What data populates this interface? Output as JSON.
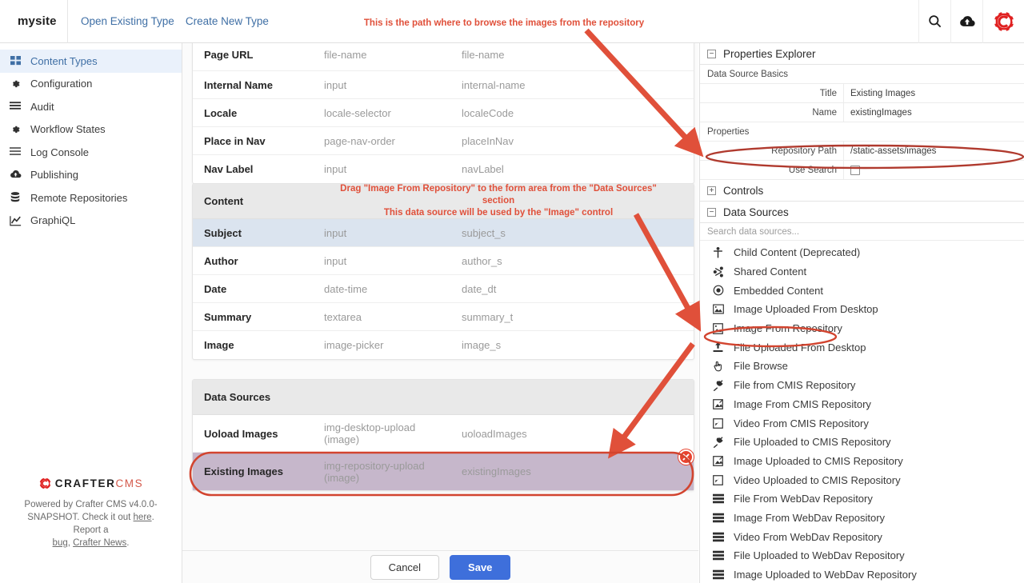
{
  "topbar": {
    "site_name": "mysite",
    "nav": [
      {
        "label": "Open Existing Type"
      },
      {
        "label": "Create New Type"
      }
    ],
    "icons": {
      "search": "search-icon",
      "publish": "cloud-upload-icon",
      "logo": "crafter-gear-logo"
    }
  },
  "sidebar": {
    "items": [
      {
        "label": "Content Types",
        "icon": "grid-icon",
        "active": true
      },
      {
        "label": "Configuration",
        "icon": "gear-icon",
        "active": false
      },
      {
        "label": "Audit",
        "icon": "list-icon",
        "active": false
      },
      {
        "label": "Workflow States",
        "icon": "gear-icon",
        "active": false
      },
      {
        "label": "Log Console",
        "icon": "list-icon",
        "active": false
      },
      {
        "label": "Publishing",
        "icon": "cloud-upload-icon",
        "active": false
      },
      {
        "label": "Remote Repositories",
        "icon": "database-icon",
        "active": false
      },
      {
        "label": "GraphiQL",
        "icon": "chart-line-icon",
        "active": false
      }
    ]
  },
  "footer": {
    "brand_main": "CRAFTER",
    "brand_sub": "CMS",
    "line1": "Powered by Crafter CMS v4.0.0-",
    "line2_a": "SNAPSHOT. Check it out ",
    "line2_link": "here",
    "line2_b": ". Report a",
    "line3_link1": "bug",
    "line3_sep": ", ",
    "line3_link2": "Crafter News",
    "line3_end": "."
  },
  "form": {
    "top_rows": [
      {
        "name": "Page URL",
        "control": "file-name",
        "field": "file-name"
      },
      {
        "name": "Internal Name",
        "control": "input",
        "field": "internal-name"
      },
      {
        "name": "Locale",
        "control": "locale-selector",
        "field": "localeCode"
      },
      {
        "name": "Place in Nav",
        "control": "page-nav-order",
        "field": "placeInNav"
      },
      {
        "name": "Nav Label",
        "control": "input",
        "field": "navLabel"
      }
    ],
    "content_section": {
      "title": "Content",
      "note_line1": "Drag \"Image From Repository\" to the form area from the \"Data Sources\" section",
      "note_line2": "This data source will be used by the \"Image\" control",
      "rows": [
        {
          "name": "Subject",
          "control": "input",
          "field": "subject_s",
          "selected": true
        },
        {
          "name": "Author",
          "control": "input",
          "field": "author_s",
          "selected": false
        },
        {
          "name": "Date",
          "control": "date-time",
          "field": "date_dt",
          "selected": false
        },
        {
          "name": "Summary",
          "control": "textarea",
          "field": "summary_t",
          "selected": false
        },
        {
          "name": "Image",
          "control": "image-picker",
          "field": "image_s",
          "selected": false
        }
      ]
    },
    "datasources_section": {
      "title": "Data Sources",
      "rows": [
        {
          "name": "Uoload Images",
          "control": "img-desktop-upload\n(image)",
          "field": "uoloadImages",
          "chosen": false
        },
        {
          "name": "Existing Images",
          "control": "img-repository-upload\n(image)",
          "field": "existingImages",
          "chosen": true
        }
      ]
    },
    "buttons": {
      "cancel": "Cancel",
      "save": "Save"
    }
  },
  "properties_explorer": {
    "title": "Properties Explorer",
    "sections": {
      "basics_title": "Data Source Basics",
      "basics_rows": [
        {
          "label": "Title",
          "value": "Existing Images"
        },
        {
          "label": "Name",
          "value": "existingImages"
        }
      ],
      "properties_title": "Properties",
      "properties_rows": [
        {
          "label": "Repository Path",
          "value": "/static-assets/images",
          "type": "text-search",
          "highlighted": true
        },
        {
          "label": "Use Search",
          "value": "",
          "type": "checkbox",
          "checked": false,
          "highlighted": false
        }
      ],
      "controls_title": "Controls",
      "datasources_title": "Data Sources"
    },
    "search_placeholder": "Search data sources...",
    "datasource_items": [
      {
        "label": "Child Content (Deprecated)",
        "icon": "person-icon",
        "highlighted": false
      },
      {
        "label": "Shared Content",
        "icon": "share-icon",
        "highlighted": false
      },
      {
        "label": "Embedded Content",
        "icon": "target-icon",
        "highlighted": false
      },
      {
        "label": "Image Uploaded From Desktop",
        "icon": "image-icon",
        "highlighted": false
      },
      {
        "label": "Image From Repository",
        "icon": "image-doc-icon",
        "highlighted": true
      },
      {
        "label": "File Uploaded From Desktop",
        "icon": "upload-icon",
        "highlighted": false
      },
      {
        "label": "File Browse",
        "icon": "hand-icon",
        "highlighted": false
      },
      {
        "label": "File from CMIS Repository",
        "icon": "plug-icon",
        "highlighted": false
      },
      {
        "label": "Image From CMIS Repository",
        "icon": "cmis-image-icon",
        "highlighted": false
      },
      {
        "label": "Video From CMIS Repository",
        "icon": "cmis-video-icon",
        "highlighted": false
      },
      {
        "label": "File Uploaded to CMIS Repository",
        "icon": "plug-icon",
        "highlighted": false
      },
      {
        "label": "Image Uploaded to CMIS Repository",
        "icon": "cmis-image-icon",
        "highlighted": false
      },
      {
        "label": "Video Uploaded to CMIS Repository",
        "icon": "cmis-video-icon",
        "highlighted": false
      },
      {
        "label": "File From WebDav Repository",
        "icon": "server-icon",
        "highlighted": false
      },
      {
        "label": "Image From WebDav Repository",
        "icon": "server-icon",
        "highlighted": false
      },
      {
        "label": "Video From WebDav Repository",
        "icon": "server-icon",
        "highlighted": false
      },
      {
        "label": "File Uploaded to WebDav Repository",
        "icon": "server-icon",
        "highlighted": false
      },
      {
        "label": "Image Uploaded to WebDav Repository",
        "icon": "server-icon",
        "highlighted": false
      }
    ]
  },
  "annotations": {
    "path_note": "This is the path where to browse the images from the repository",
    "accent_color": "#e0503a"
  }
}
